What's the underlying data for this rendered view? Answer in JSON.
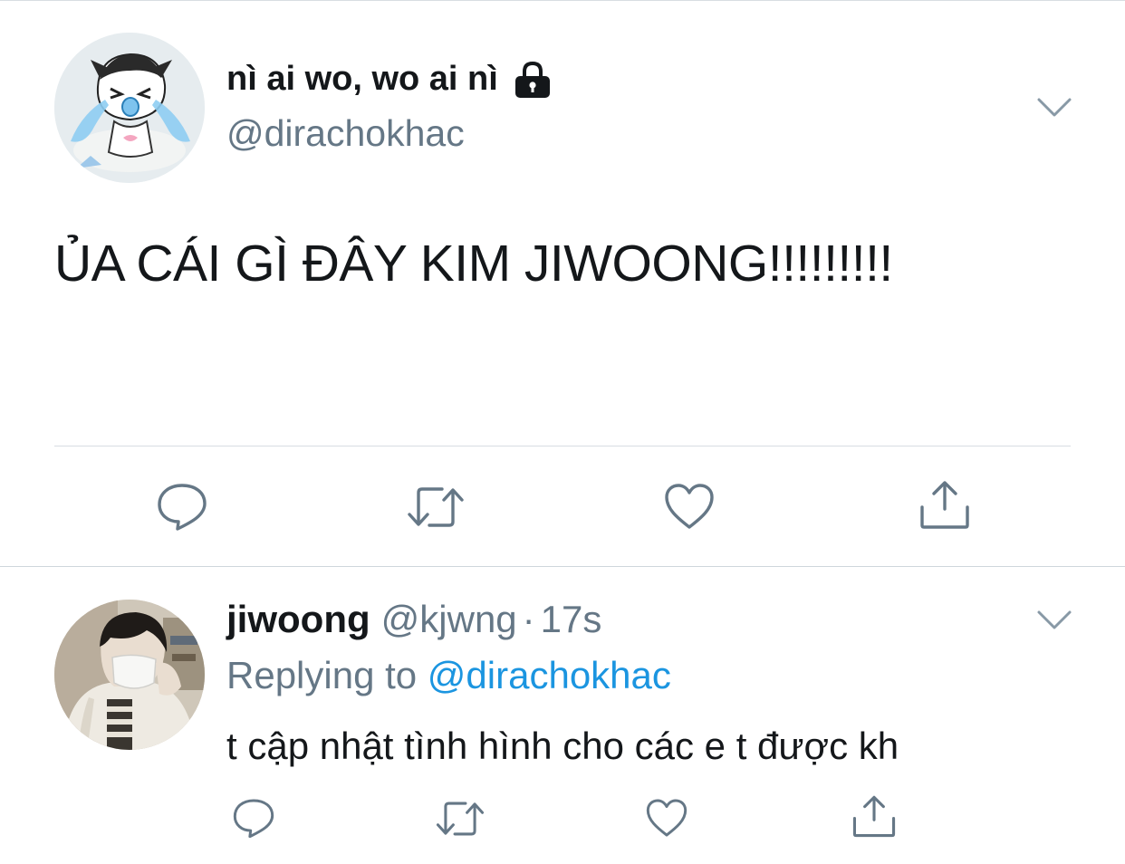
{
  "main_tweet": {
    "display_name": "nì ai wo, wo ai nì",
    "handle": "@dirachokhac",
    "text": "ỦA CÁI GÌ ĐÂY KIM JIWOONG!!!!!!!!!",
    "protected_icon": "lock-icon",
    "menu_icon": "chevron-down-icon",
    "actions": [
      "reply-icon",
      "retweet-icon",
      "like-icon",
      "share-icon"
    ]
  },
  "reply_tweet": {
    "display_name": "jiwoong",
    "handle": "@kjwng",
    "separator": "·",
    "time": "17s",
    "replying_prefix": "Replying to",
    "replying_to": "@dirachokhac",
    "text": "t cập nhật tình hình cho các e t được kh",
    "menu_icon": "chevron-down-icon",
    "actions": [
      "reply-icon",
      "retweet-icon",
      "like-icon",
      "share-icon"
    ]
  },
  "colors": {
    "primary_text": "#14171a",
    "secondary_text": "#657786",
    "link": "#1b95e0",
    "icon": "#657786",
    "divider": "#d8dde2",
    "background": "#ffffff"
  }
}
